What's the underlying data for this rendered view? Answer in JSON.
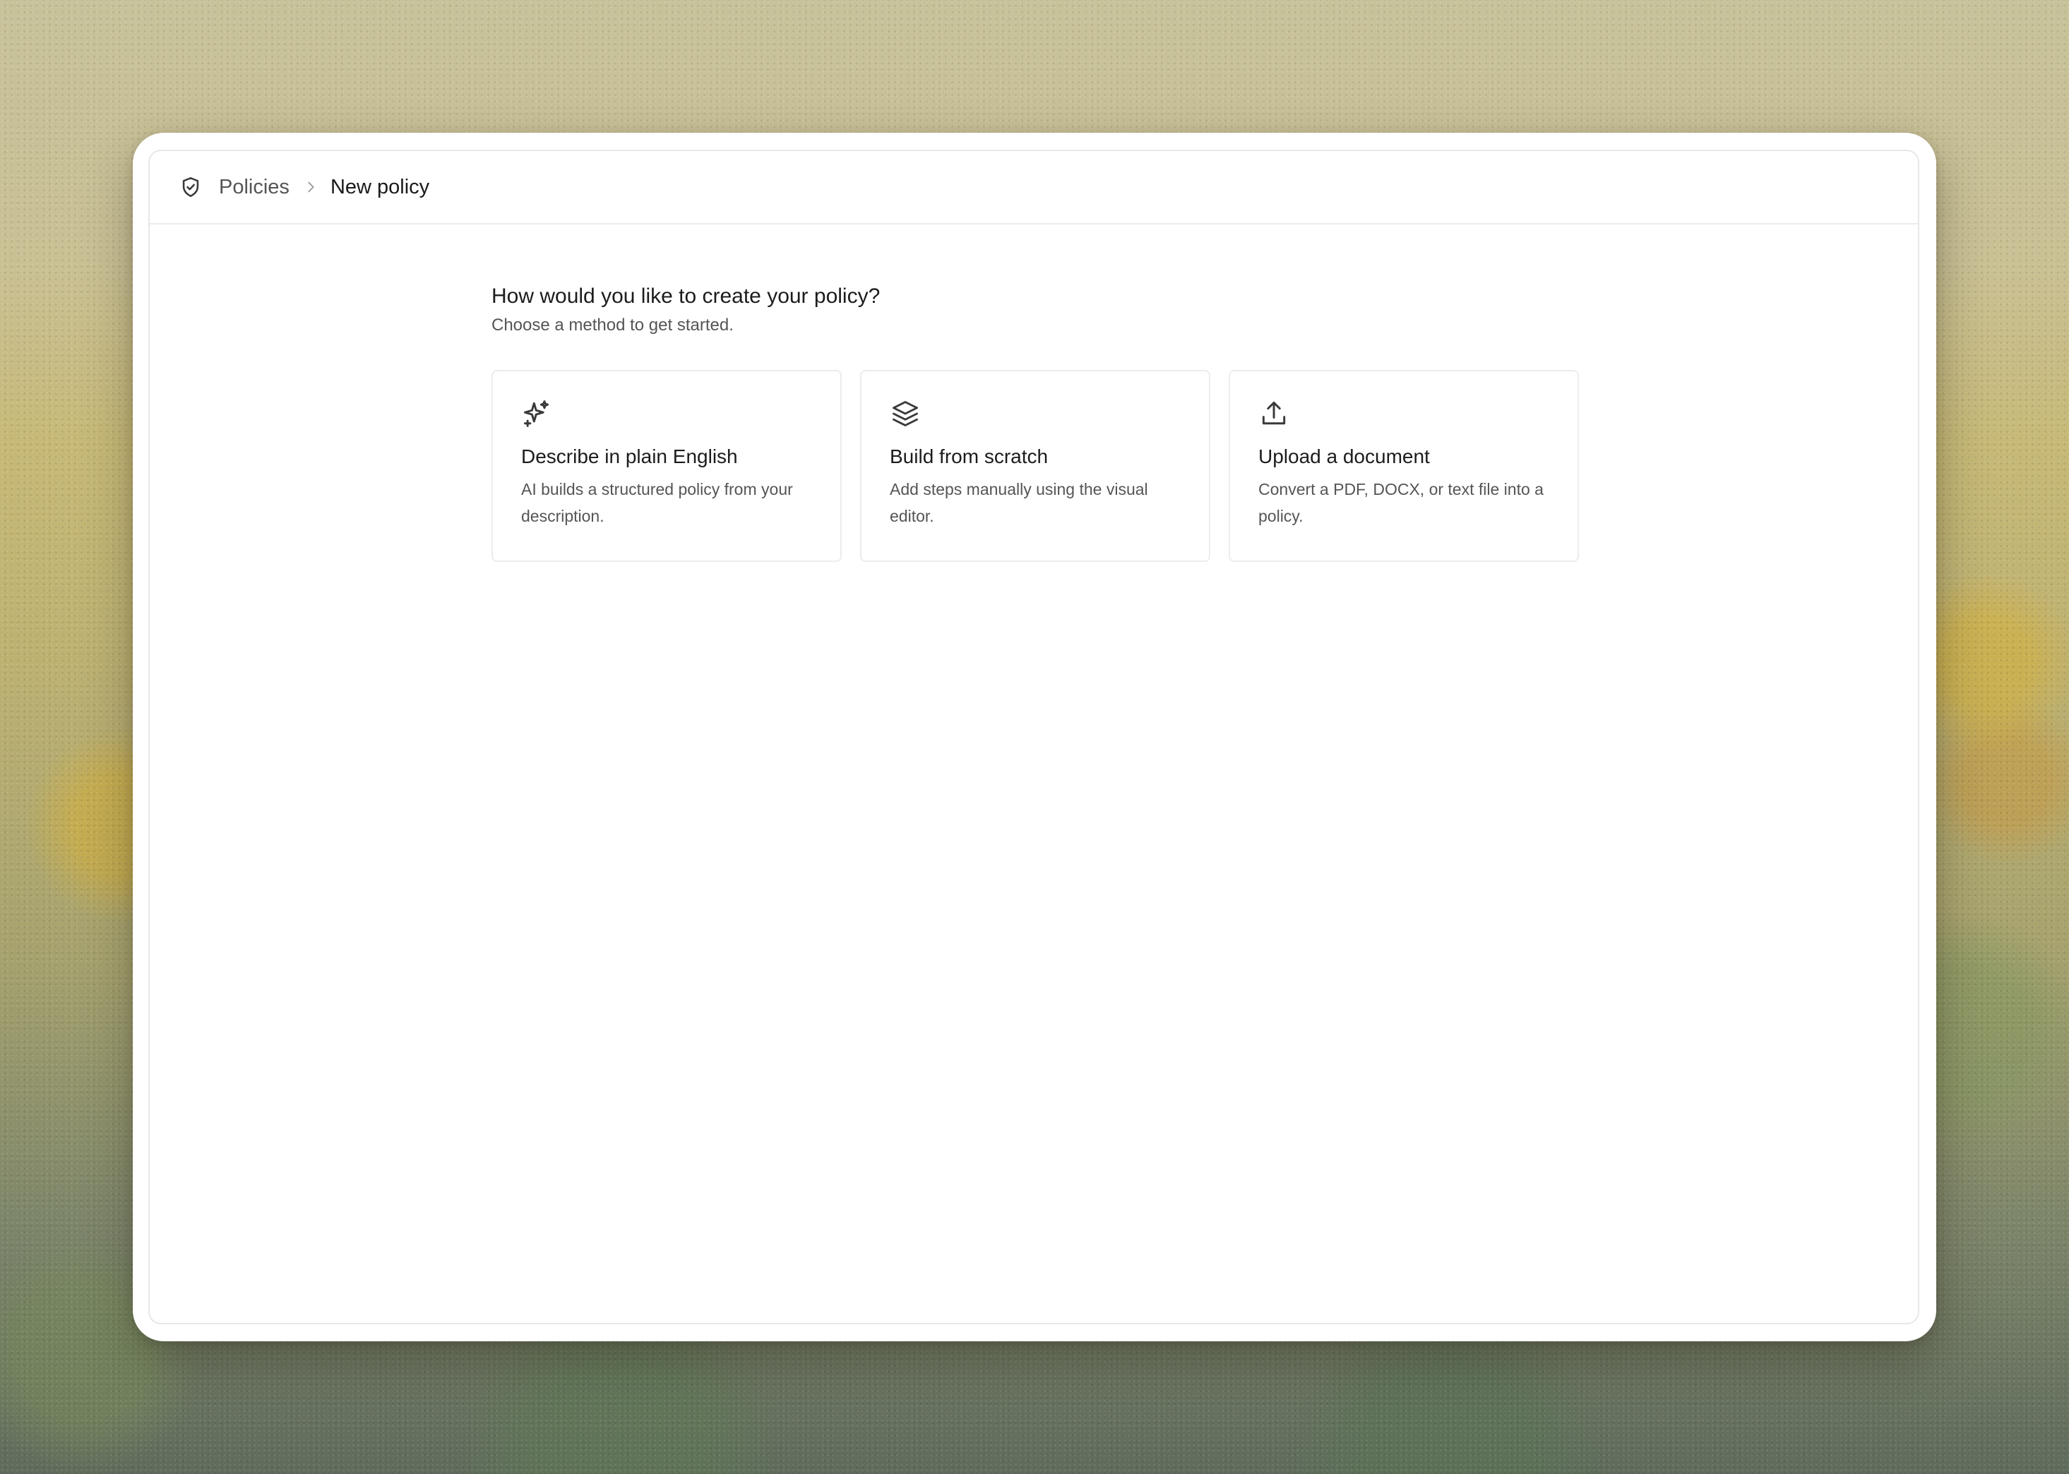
{
  "breadcrumb": {
    "icon": "shield-check-icon",
    "parent_label": "Policies",
    "separator_icon": "chevron-right-icon",
    "current_label": "New policy"
  },
  "main": {
    "heading": "How would you like to create your policy?",
    "subheading": "Choose a method to get started."
  },
  "options": [
    {
      "icon": "sparkles-icon",
      "title": "Describe in plain English",
      "description": "AI builds a structured policy from your description."
    },
    {
      "icon": "layers-icon",
      "title": "Build from scratch",
      "description": "Add steps manually using the visual editor."
    },
    {
      "icon": "upload-icon",
      "title": "Upload a document",
      "description": "Convert a PDF, DOCX, or text file into a policy."
    }
  ],
  "colors": {
    "text_primary": "#1c1c1c",
    "text_secondary": "#555555",
    "border": "#ececec",
    "icon": "#3a3a3a"
  }
}
